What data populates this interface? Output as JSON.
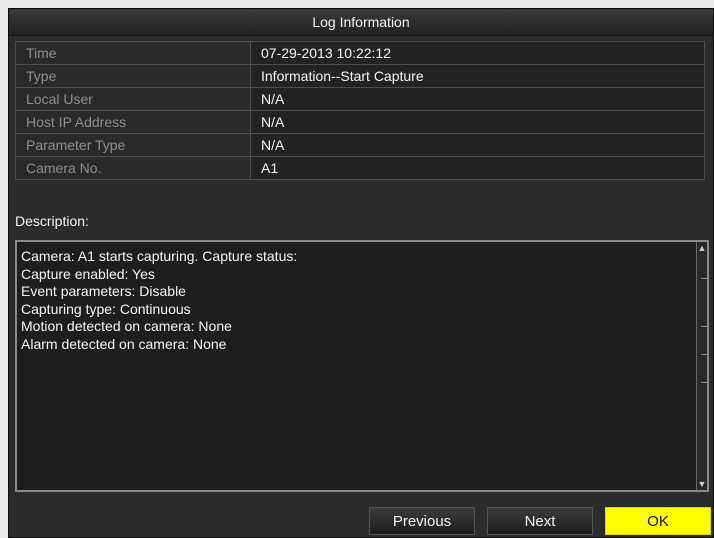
{
  "dialog": {
    "title": "Log Information"
  },
  "details": {
    "rows": [
      {
        "label": "Time",
        "value": "07-29-2013 10:22:12"
      },
      {
        "label": "Type",
        "value": "Information--Start Capture"
      },
      {
        "label": "Local User",
        "value": "N/A"
      },
      {
        "label": "Host IP Address",
        "value": "N/A"
      },
      {
        "label": "Parameter Type",
        "value": "N/A"
      },
      {
        "label": "Camera No.",
        "value": "A1"
      }
    ]
  },
  "description": {
    "label": "Description:",
    "lines": [
      "Camera: A1 starts capturing. Capture status:",
      "Capture enabled: Yes",
      "Event parameters: Disable",
      "Capturing type: Continuous",
      "Motion detected on camera: None",
      "Alarm detected on camera: None"
    ]
  },
  "buttons": {
    "previous": "Previous",
    "next": "Next",
    "ok": "OK"
  },
  "colors": {
    "ok_button": "#ffff00",
    "background": "#2c2c2c"
  },
  "icons": {
    "scroll_up": "scroll-up-arrow-icon",
    "scroll_down": "scroll-down-arrow-icon"
  }
}
